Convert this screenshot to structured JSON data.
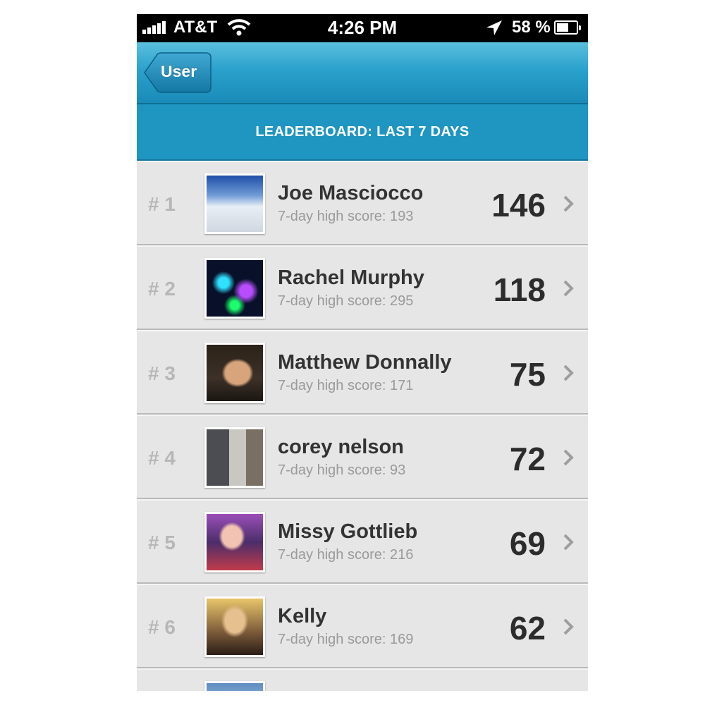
{
  "status_bar": {
    "carrier": "AT&T",
    "time": "4:26 PM",
    "battery": "58 %",
    "icons": [
      "signal-bars-icon",
      "wifi-icon",
      "location-arrow-icon",
      "battery-icon"
    ]
  },
  "nav": {
    "back_label": "User"
  },
  "section": {
    "title": "LEADERBOARD: LAST 7 DAYS"
  },
  "colors": {
    "nav_bar": "#2aa1cc",
    "section_header": "#1f95c2",
    "row_background": "#e6e6e6"
  },
  "leaderboard": [
    {
      "rank": "# 1",
      "name": "Joe Masciocco",
      "subtitle": "7-day high score: 193",
      "score": "146"
    },
    {
      "rank": "# 2",
      "name": "Rachel Murphy",
      "subtitle": "7-day high score: 295",
      "score": "118"
    },
    {
      "rank": "# 3",
      "name": "Matthew Donnally",
      "subtitle": "7-day high score: 171",
      "score": "75"
    },
    {
      "rank": "# 4",
      "name": "corey nelson",
      "subtitle": "7-day high score: 93",
      "score": "72"
    },
    {
      "rank": "# 5",
      "name": "Missy Gottlieb",
      "subtitle": "7-day high score: 216",
      "score": "69"
    },
    {
      "rank": "# 6",
      "name": "Kelly",
      "subtitle": "7-day high score: 169",
      "score": "62"
    }
  ]
}
